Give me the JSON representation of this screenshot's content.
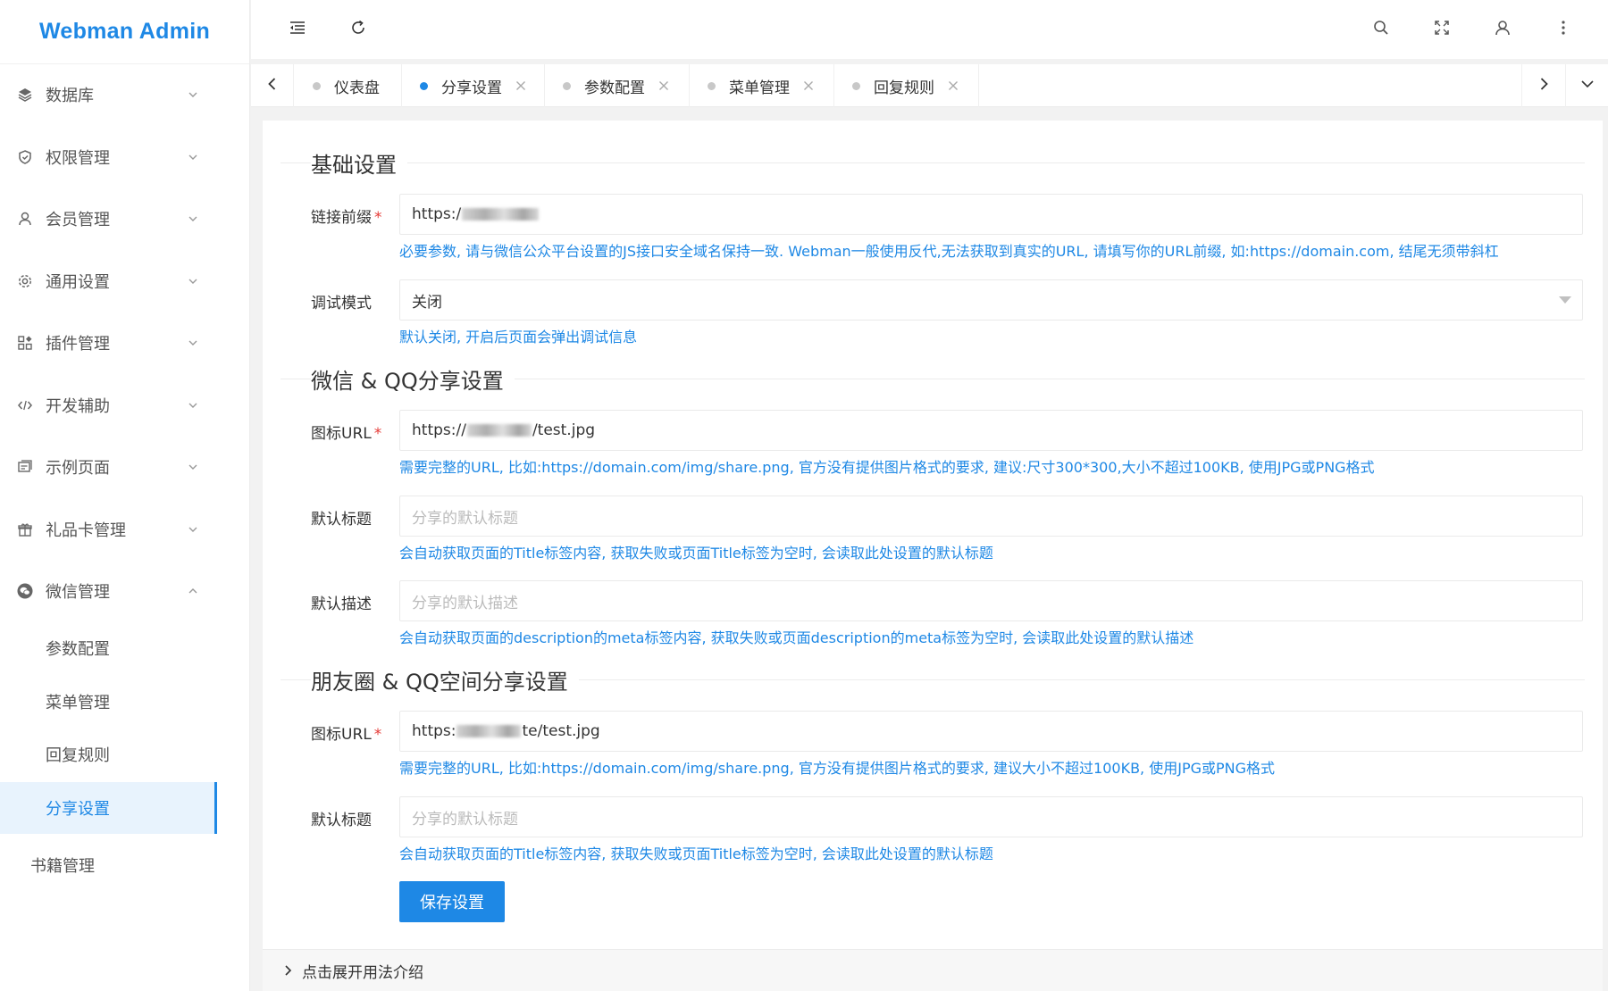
{
  "app": {
    "title": "Webman Admin"
  },
  "sidebar": {
    "items": [
      {
        "label": "数据库",
        "icon": "layers-icon"
      },
      {
        "label": "权限管理",
        "icon": "shield-icon"
      },
      {
        "label": "会员管理",
        "icon": "user-icon"
      },
      {
        "label": "通用设置",
        "icon": "gear-icon"
      },
      {
        "label": "插件管理",
        "icon": "apps-icon"
      },
      {
        "label": "开发辅助",
        "icon": "code-icon"
      },
      {
        "label": "示例页面",
        "icon": "template-icon"
      },
      {
        "label": "礼品卡管理",
        "icon": "gift-icon"
      },
      {
        "label": "微信管理",
        "icon": "wechat-icon"
      }
    ],
    "wechat_children": [
      {
        "label": "参数配置"
      },
      {
        "label": "菜单管理"
      },
      {
        "label": "回复规则"
      },
      {
        "label": "分享设置"
      }
    ],
    "books": {
      "label": "书籍管理"
    }
  },
  "tabs": [
    {
      "label": "仪表盘",
      "active": false,
      "closable": false
    },
    {
      "label": "分享设置",
      "active": true,
      "closable": true
    },
    {
      "label": "参数配置",
      "active": false,
      "closable": true
    },
    {
      "label": "菜单管理",
      "active": false,
      "closable": true
    },
    {
      "label": "回复规则",
      "active": false,
      "closable": true
    }
  ],
  "form": {
    "basic": {
      "title": "基础设置",
      "link_prefix": {
        "label": "链接前缀",
        "value_prefix": "https:/",
        "help": "必要参数, 请与微信公众平台设置的JS接口安全域名保持一致. Webman一般使用反代,无法获取到真实的URL, 请填写你的URL前缀, 如:https://domain.com, 结尾无须带斜杠"
      },
      "debug_mode": {
        "label": "调试模式",
        "value": "关闭",
        "help": "默认关闭, 开启后页面会弹出调试信息"
      }
    },
    "wechat_qq": {
      "title": "微信 & QQ分享设置",
      "icon_url": {
        "label": "图标URL",
        "value_prefix": "https://",
        "value_suffix": "/test.jpg",
        "help": "需要完整的URL, 比如:https://domain.com/img/share.png, 官方没有提供图片格式的要求, 建议:尺寸300*300,大小不超过100KB, 使用JPG或PNG格式"
      },
      "default_title": {
        "label": "默认标题",
        "placeholder": "分享的默认标题",
        "help": "会自动获取页面的Title标签内容, 获取失败或页面Title标签为空时, 会读取此处设置的默认标题"
      },
      "default_desc": {
        "label": "默认描述",
        "placeholder": "分享的默认描述",
        "help": "会自动获取页面的description的meta标签内容, 获取失败或页面description的meta标签为空时, 会读取此处设置的默认描述"
      }
    },
    "moments_qzone": {
      "title": "朋友圈 & QQ空间分享设置",
      "icon_url": {
        "label": "图标URL",
        "value_prefix": "https:",
        "value_suffix": "te/test.jpg",
        "help": "需要完整的URL, 比如:https://domain.com/img/share.png, 官方没有提供图片格式的要求, 建议大小不超过100KB, 使用JPG或PNG格式"
      },
      "default_title": {
        "label": "默认标题",
        "placeholder": "分享的默认标题",
        "help": "会自动获取页面的Title标签内容, 获取失败或页面Title标签为空时, 会读取此处设置的默认标题"
      }
    },
    "save_label": "保存设置",
    "usage_toggle": "点击展开用法介绍"
  },
  "colors": {
    "accent": "#1e88e5",
    "required": "#e53935"
  }
}
